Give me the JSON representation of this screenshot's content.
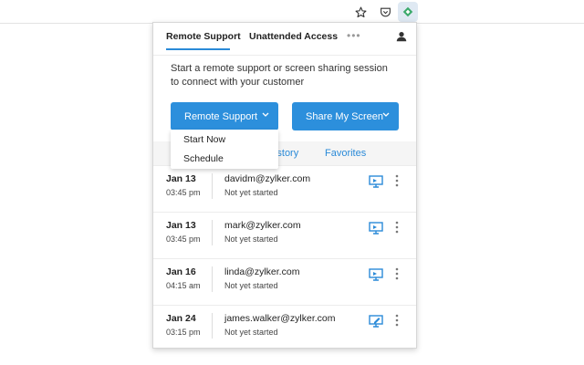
{
  "tabs": {
    "remote_support": "Remote Support",
    "unattended_access": "Unattended Access",
    "more": "•••"
  },
  "intro_text": "Start a remote support or screen sharing session to connect with your customer",
  "buttons": {
    "remote_support": "Remote Support",
    "share_my_screen": "Share My Screen"
  },
  "dropdown": {
    "start_now": "Start Now",
    "schedule": "Schedule"
  },
  "history_tabs": {
    "history": "History",
    "favorites": "Favorites"
  },
  "sessions": [
    {
      "date": "Jan 13",
      "time": "03:45 pm",
      "email": "davidm@zylker.com",
      "status": "Not yet started"
    },
    {
      "date": "Jan 13",
      "time": "03:45 pm",
      "email": "mark@zylker.com",
      "status": "Not yet started"
    },
    {
      "date": "Jan 16",
      "time": "04:15 am",
      "email": "linda@zylker.com",
      "status": "Not yet started"
    },
    {
      "date": "Jan 24",
      "time": "03:15 pm",
      "email": "james.walker@zylker.com",
      "status": "Not yet started"
    }
  ],
  "colors": {
    "accent": "#2c8fdc",
    "link": "#2a8ad8"
  },
  "icons": {
    "star": "star-icon",
    "pocket": "pocket-icon",
    "extension": "assist-extension-icon",
    "user": "user-icon",
    "screen": "screen-share-icon",
    "more": "more-vertical-icon"
  }
}
